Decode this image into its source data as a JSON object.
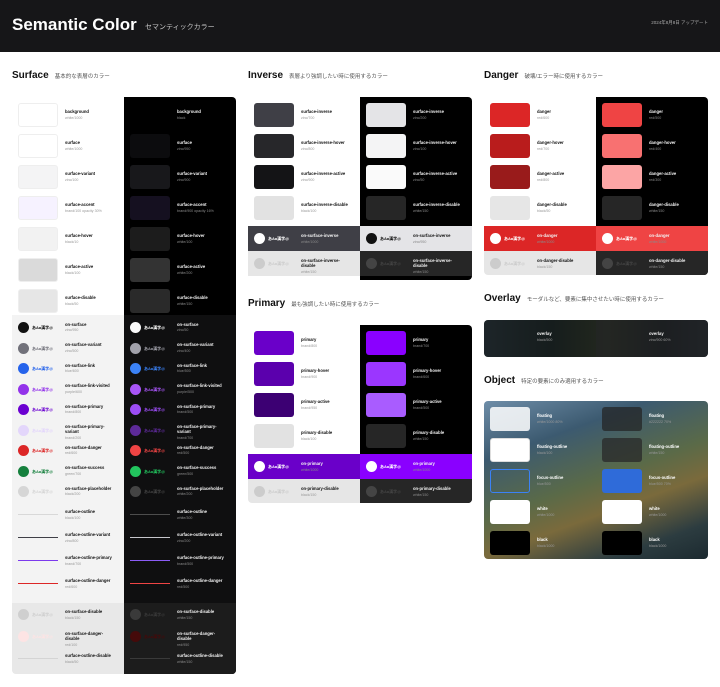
{
  "header": {
    "title": "Semantic Color",
    "subtitle": "セマンティックカラー",
    "date": "2024年8月8日 アップデート"
  },
  "sample_text": "あAa漢字@",
  "surface": {
    "title": "Surface",
    "desc": "基本的な表層のカラー",
    "light": [
      {
        "name": "background",
        "val": "white/1000",
        "color": "#ffffff"
      },
      {
        "name": "surface",
        "val": "white/1000",
        "color": "#ffffff"
      },
      {
        "name": "surface-variant",
        "val": "zinc/100",
        "color": "#f4f4f5"
      },
      {
        "name": "surface-accent",
        "val": "brand/100 opacity 30%",
        "color": "#f6f2ff"
      },
      {
        "name": "surface-hover",
        "val": "black/10",
        "color": "#f2f2f2"
      },
      {
        "name": "surface-active",
        "val": "black/100",
        "color": "#dadada"
      },
      {
        "name": "surface-disable",
        "val": "black/50",
        "color": "#e6e6e6"
      }
    ],
    "dark": [
      {
        "name": "background",
        "val": "black",
        "color": "#000000"
      },
      {
        "name": "surface",
        "val": "zinc/950",
        "color": "#0c0c0e"
      },
      {
        "name": "surface-variant",
        "val": "zinc/900",
        "color": "#18181b"
      },
      {
        "name": "surface-accent",
        "val": "brand/900 opacity 16%",
        "color": "#151020"
      },
      {
        "name": "surface-hover",
        "val": "white/100",
        "color": "#1c1c1c"
      },
      {
        "name": "surface-active",
        "val": "white/200",
        "color": "#333333"
      },
      {
        "name": "surface-disable",
        "val": "white/150",
        "color": "#2a2a2a"
      }
    ],
    "on_light": [
      {
        "name": "on-surface",
        "val": "zinc/950",
        "color": "#111111"
      },
      {
        "name": "on-surface-variant",
        "val": "zinc/500",
        "color": "#71717a"
      },
      {
        "name": "on-surface-link",
        "val": "blue/600",
        "color": "#2563eb"
      },
      {
        "name": "on-surface-link-visited",
        "val": "purple/600",
        "color": "#9333ea"
      },
      {
        "name": "on-surface-primary",
        "val": "brand/800",
        "color": "#6b00d1"
      },
      {
        "name": "on-surface-primary-variant",
        "val": "brand/200",
        "color": "#e3d6fb"
      },
      {
        "name": "on-surface-danger",
        "val": "red/600",
        "color": "#dc2626"
      },
      {
        "name": "on-surface-success",
        "val": "green/700",
        "color": "#15803d"
      },
      {
        "name": "on-surface-placeholder",
        "val": "black/200",
        "color": "#d6d6d6"
      }
    ],
    "on_dark": [
      {
        "name": "on-surface",
        "val": "zinc/50",
        "color": "#fafafa"
      },
      {
        "name": "on-surface-variant",
        "val": "zinc/400",
        "color": "#a1a1aa"
      },
      {
        "name": "on-surface-link",
        "val": "blue/500",
        "color": "#3b82f6"
      },
      {
        "name": "on-surface-link-visited",
        "val": "purple/500",
        "color": "#a855f7"
      },
      {
        "name": "on-surface-primary",
        "val": "brand/500",
        "color": "#9c4df5"
      },
      {
        "name": "on-surface-primary-variant",
        "val": "brand/700",
        "color": "#5d2a99"
      },
      {
        "name": "on-surface-danger",
        "val": "red/500",
        "color": "#ef4444"
      },
      {
        "name": "on-surface-success",
        "val": "green/500",
        "color": "#22c55e"
      },
      {
        "name": "on-surface-placeholder",
        "val": "white/200",
        "color": "#444444"
      }
    ],
    "outline_light": [
      {
        "name": "surface-outline",
        "val": "black/100",
        "color": "#d8d8d8"
      },
      {
        "name": "surface-outline-variant",
        "val": "zinc/800",
        "color": "#3f3f46"
      },
      {
        "name": "surface-outline-primary",
        "val": "brand/700",
        "color": "#7c3aed"
      },
      {
        "name": "surface-outline-danger",
        "val": "red/600",
        "color": "#dc2626"
      }
    ],
    "outline_dark": [
      {
        "name": "surface-outline",
        "val": "white/300",
        "color": "#4d4d4d"
      },
      {
        "name": "surface-outline-variant",
        "val": "zinc/200",
        "color": "#c6c6cc"
      },
      {
        "name": "surface-outline-primary",
        "val": "brand/500",
        "color": "#8b5cf6"
      },
      {
        "name": "surface-outline-danger",
        "val": "red/500",
        "color": "#ef4444"
      }
    ],
    "disable_light": [
      {
        "name": "on-surface-disable",
        "val": "black/150",
        "color": "#cfcfcf"
      },
      {
        "name": "on-surface-danger-disable",
        "val": "red/100",
        "color": "#fde4e4"
      },
      {
        "name": "surface-outline-disable",
        "val": "black/50",
        "color": "#d4d4d4"
      }
    ],
    "disable_dark": [
      {
        "name": "on-surface-disable",
        "val": "white/150",
        "color": "#3a3a3a"
      },
      {
        "name": "on-surface-danger-disable",
        "val": "red/950",
        "color": "#450a0a"
      },
      {
        "name": "surface-outline-disable",
        "val": "white/150",
        "color": "#3a3a3a"
      }
    ]
  },
  "inverse": {
    "title": "Inverse",
    "desc": "表層より強調したい時に使用するカラー",
    "light": [
      {
        "name": "surface-inverse",
        "val": "zinc/700",
        "color": "#3f3f46"
      },
      {
        "name": "surface-inverse-hover",
        "val": "zinc/800",
        "color": "#27272a"
      },
      {
        "name": "surface-inverse-active",
        "val": "zinc/900",
        "color": "#141416"
      },
      {
        "name": "surface-inverse-disable",
        "val": "black/100",
        "color": "#e2e2e2"
      }
    ],
    "dark": [
      {
        "name": "surface-inverse",
        "val": "zinc/200",
        "color": "#e4e4e7"
      },
      {
        "name": "surface-inverse-hover",
        "val": "zinc/100",
        "color": "#f4f4f5"
      },
      {
        "name": "surface-inverse-active",
        "val": "zinc/50",
        "color": "#fafafa"
      },
      {
        "name": "surface-inverse-disable",
        "val": "white/150",
        "color": "#262626"
      }
    ],
    "on": [
      {
        "name": "on-surface-inverse",
        "val": "white/1000",
        "val_dark": "zinc/950"
      }
    ],
    "on_dis": [
      {
        "name": "on-surface-inverse-disable",
        "val": "white/150",
        "val_dark": "white/150"
      }
    ]
  },
  "primary": {
    "title": "Primary",
    "desc": "最も強調したい時に使用するカラー",
    "light": [
      {
        "name": "primary",
        "val": "brand/800",
        "color": "#6a00c9"
      },
      {
        "name": "primary-hover",
        "val": "brand/900",
        "color": "#5b00ad"
      },
      {
        "name": "primary-active",
        "val": "brand/950",
        "color": "#3c0073"
      },
      {
        "name": "primary-disable",
        "val": "black/100",
        "color": "#e2e2e2"
      }
    ],
    "dark": [
      {
        "name": "primary",
        "val": "brand/700",
        "color": "#8a00ff"
      },
      {
        "name": "primary-hover",
        "val": "brand/600",
        "color": "#9b36ff"
      },
      {
        "name": "primary-active",
        "val": "brand/500",
        "color": "#a95cff"
      },
      {
        "name": "primary-disable",
        "val": "white/150",
        "color": "#262626"
      }
    ],
    "on": [
      {
        "name": "on-primary",
        "val": "white/1000",
        "val_dark": "white/1000"
      }
    ],
    "on_dis": [
      {
        "name": "on-primary-disable",
        "val": "black/150",
        "val_dark": "white/150"
      }
    ]
  },
  "danger": {
    "title": "Danger",
    "desc": "破壊/エラー時に使用するカラー",
    "light": [
      {
        "name": "danger",
        "val": "red/600",
        "color": "#dc2626"
      },
      {
        "name": "danger-hover",
        "val": "red/700",
        "color": "#b91c1c"
      },
      {
        "name": "danger-active",
        "val": "red/800",
        "color": "#991b1b"
      },
      {
        "name": "danger-disable",
        "val": "black/50",
        "color": "#e6e6e6"
      }
    ],
    "dark": [
      {
        "name": "danger",
        "val": "red/500",
        "color": "#ef4444"
      },
      {
        "name": "danger-hover",
        "val": "red/400",
        "color": "#f87171"
      },
      {
        "name": "danger-active",
        "val": "red/300",
        "color": "#fca5a5"
      },
      {
        "name": "danger-disable",
        "val": "white/150",
        "color": "#262626"
      }
    ],
    "on": [
      {
        "name": "on-danger",
        "val": "white/1000",
        "val_dark": "white/1000"
      }
    ],
    "on_dis": [
      {
        "name": "on-danger-disable",
        "val": "black/150",
        "val_dark": "white/150"
      }
    ]
  },
  "overlay": {
    "title": "Overlay",
    "desc": "モーダルなど、要素に集中させたい時に使用するカラー",
    "name": "overlay",
    "val": "black/500",
    "val_dark": "zinc/900 60%"
  },
  "object": {
    "title": "Object",
    "desc": "特定の要素にのみ適用するカラー",
    "items": [
      {
        "name": "floating",
        "val": "white/1000 80%",
        "val_dark": "#222222 70%",
        "color": "rgba(255,255,255,0.85)",
        "color_dark": "rgba(34,34,34,0.72)"
      },
      {
        "name": "floating-outline",
        "val": "black/100",
        "val_dark": "white/150",
        "color": "#ffffff",
        "color_dark": "rgba(40,40,40,0.75)"
      },
      {
        "name": "focus-outline",
        "val": "blue/500",
        "val_dark": "blue/500 70%",
        "color": "rgba(0,0,0,0)",
        "color_dark": "#2f6bd9"
      },
      {
        "name": "white",
        "val": "white/1000",
        "val_dark": "white/1000",
        "color": "#ffffff",
        "color_dark": "#ffffff"
      },
      {
        "name": "black",
        "val": "black/1000",
        "val_dark": "black/1000",
        "color": "#000000",
        "color_dark": "#000000"
      }
    ]
  }
}
